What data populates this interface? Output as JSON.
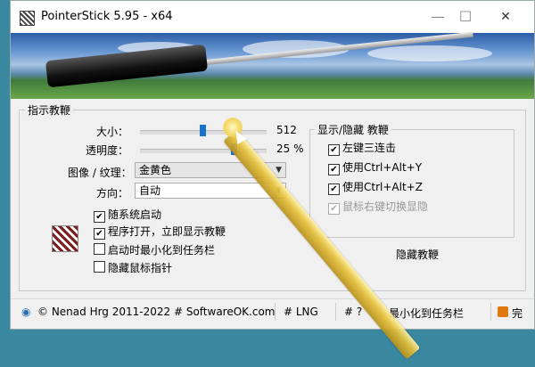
{
  "window": {
    "title": "PointerStick 5.95 - x64",
    "minimize": "—",
    "maximize": "☐",
    "close": "✕"
  },
  "pointer_group": {
    "title": "指示教鞭",
    "size_label": "大小：",
    "size_value": "512",
    "size_fraction": 0.47,
    "opacity_label": "透明度：",
    "opacity_value": "25 %",
    "opacity_fraction": 0.72,
    "image_label": "图像 / 纹理：",
    "image_value": "金黄色",
    "direction_label": "方向：",
    "direction_value": "自动",
    "options": [
      {
        "label": "随系统启动",
        "checked": true
      },
      {
        "label": "程序打开，立即显示教鞭",
        "checked": true
      },
      {
        "label": "启动时最小化到任务栏",
        "checked": false
      },
      {
        "label": "隐藏鼠标指针",
        "checked": false
      }
    ]
  },
  "show_group": {
    "title": "显示/隐藏 教鞭",
    "options": [
      {
        "label": "左键三连击",
        "checked": true,
        "disabled": false
      },
      {
        "label": "使用Ctrl+Alt+Y",
        "checked": true,
        "disabled": false
      },
      {
        "label": "使用Ctrl+Alt+Z",
        "checked": true,
        "disabled": false
      },
      {
        "label": "鼠标右键切换显隐",
        "checked": true,
        "disabled": true
      }
    ],
    "hide_link": "隐藏教鞭"
  },
  "statusbar": {
    "copyright": "© Nenad Hrg 2011-2022 # SoftwareOK.com",
    "lng": "# LNG",
    "help": "# ?",
    "minimize": "最小化到任务栏",
    "done": "完"
  },
  "colors": {
    "accent": "#1a73c9",
    "stick": "#e6c13a",
    "desktop": "#3a87a0"
  }
}
